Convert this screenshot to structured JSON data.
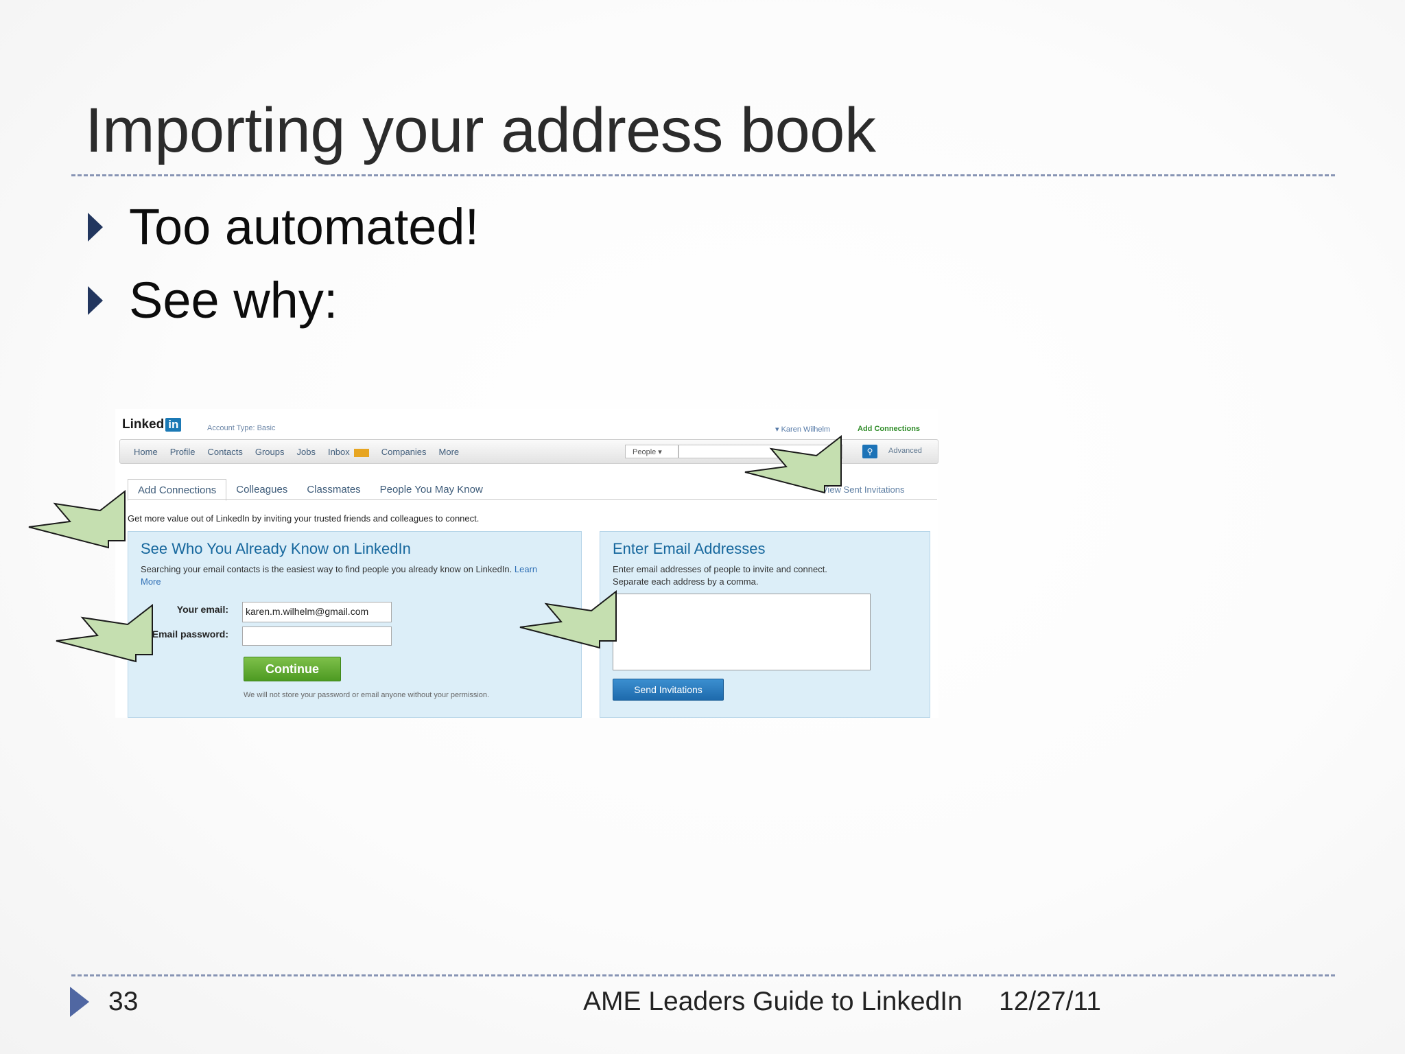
{
  "slide": {
    "title": "Importing your address book",
    "bullets": [
      "Too automated!",
      "See why:"
    ],
    "footer": {
      "page_number": "33",
      "text": "AME Leaders Guide to LinkedIn",
      "date": "12/27/11"
    }
  },
  "screenshot": {
    "logo_text": "Linked",
    "logo_in": "in",
    "account_type": "Account Type: Basic",
    "user_name": "▾ Karen Wilhelm",
    "add_connections_link": "Add Connections",
    "nav": [
      "Home",
      "Profile",
      "Contacts",
      "Groups",
      "Jobs",
      "Inbox",
      "Companies",
      "More"
    ],
    "search_scope": "People ▾",
    "advanced_link": "Advanced",
    "tabs": [
      "Add Connections",
      "Colleagues",
      "Classmates",
      "People You May Know"
    ],
    "view_sent_link": "View Sent Invitations",
    "intro_text": "Get more value out of LinkedIn by inviting your trusted friends and colleagues to connect.",
    "left_panel": {
      "title": "See Who You Already Know on LinkedIn",
      "desc": "Searching your email contacts is the easiest way to find people you already know on LinkedIn.",
      "learn_more": "Learn More",
      "email_label": "Your email:",
      "email_value": "karen.m.wilhelm@gmail.com",
      "password_label": "Email password:",
      "continue_label": "Continue",
      "notice": "We will not store your password or email anyone without your permission."
    },
    "right_panel": {
      "title": "Enter Email Addresses",
      "desc_line1": "Enter email addresses of people to invite and connect.",
      "desc_line2": "Separate each address by a comma.",
      "send_label": "Send Invitations"
    }
  },
  "colors": {
    "title_text": "#2b2b2b",
    "rule": "#8794b4",
    "bullet_marker": "#22365e",
    "arrow_fill": "#c5dfb0",
    "linkedin_blue": "#1b79b5",
    "continue_green": "#5ca52c"
  }
}
